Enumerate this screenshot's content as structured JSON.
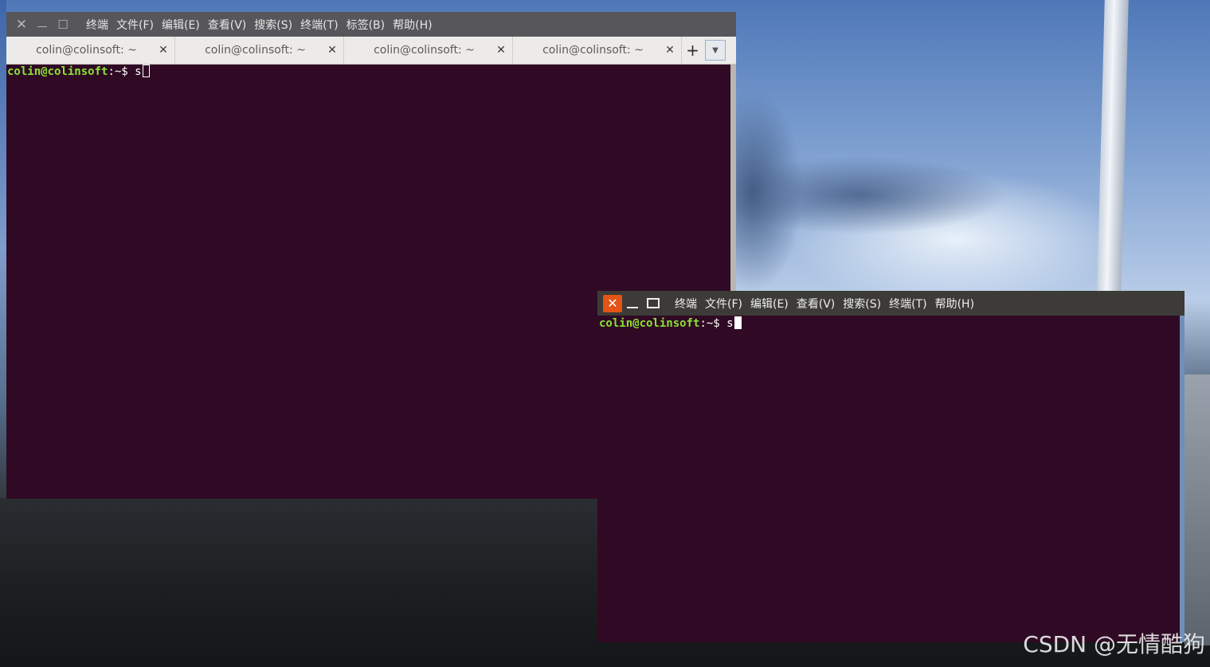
{
  "window1": {
    "controls": {
      "close": "✕",
      "minimize": "—",
      "maximize": "☐"
    },
    "menu": [
      "终端",
      "文件(F)",
      "编辑(E)",
      "查看(V)",
      "搜索(S)",
      "终端(T)",
      "标签(B)",
      "帮助(H)"
    ],
    "tabs": [
      {
        "label": "colin@colinsoft: ~",
        "close": "✕"
      },
      {
        "label": "colin@colinsoft: ~",
        "close": "✕"
      },
      {
        "label": "colin@colinsoft: ~",
        "close": "✕"
      },
      {
        "label": "colin@colinsoft: ~",
        "close": "✕"
      }
    ],
    "new_tab": "+",
    "tab_menu": "▼",
    "prompt": {
      "user_host": "colin@colinsoft",
      "path": ":~$ ",
      "input": "s"
    }
  },
  "window2": {
    "controls": {
      "close": "✕"
    },
    "menu": [
      "终端",
      "文件(F)",
      "编辑(E)",
      "查看(V)",
      "搜索(S)",
      "终端(T)",
      "帮助(H)"
    ],
    "prompt": {
      "user_host": "colin@colinsoft",
      "path": ":~$ ",
      "input": "s"
    }
  },
  "watermark": "CSDN @无情酷狗",
  "colors": {
    "terminal_bg": "#300a24",
    "prompt_user": "#8ae234",
    "close_button": "#e35416"
  }
}
